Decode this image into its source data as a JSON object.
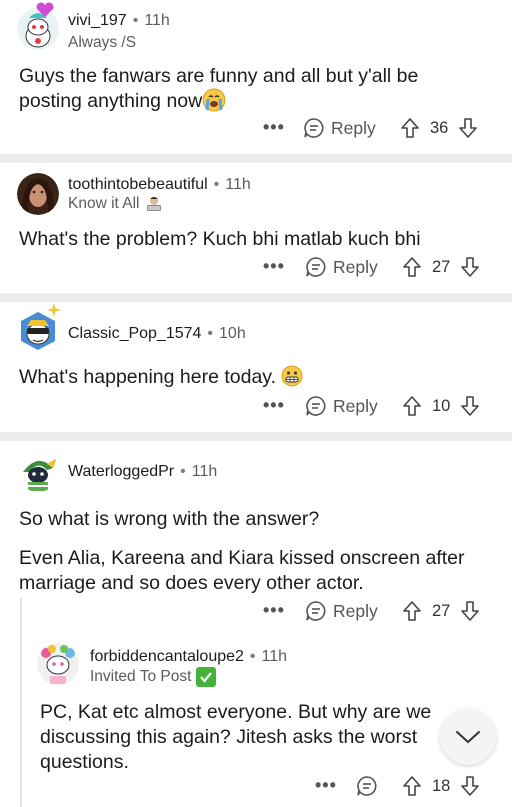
{
  "comments": [
    {
      "username": "vivi_197",
      "time": "11h",
      "flair": "Always /S",
      "text_lines": [
        "Guys the fanwars are funny and all but y'all be",
        "posting anything now"
      ],
      "reply_label": "Reply",
      "votes": "36",
      "avatar_icon": "snoo-avatar-icon",
      "emoji": "crying-face-emoji"
    },
    {
      "username": "toothintobebeautiful",
      "time": "11h",
      "flair": "Know it All",
      "text_lines": [
        "What's the problem? Kuch bhi matlab kuch bhi"
      ],
      "reply_label": "Reply",
      "votes": "27",
      "avatar_icon": "photo-avatar-icon",
      "flair_emoji": "person-at-laptop-emoji"
    },
    {
      "username": "Classic_Pop_1574",
      "time": "10h",
      "flair": "",
      "text_lines": [
        "What's happening here today."
      ],
      "reply_label": "Reply",
      "votes": "10",
      "avatar_icon": "snoo-avatar-icon",
      "emoji": "grimacing-face-emoji"
    },
    {
      "username": "WaterloggedPr",
      "time": "11h",
      "flair": "",
      "text_lines": [
        "So what is wrong with the answer?",
        "Even Alia, Kareena and Kiara kissed onscreen after",
        "marriage and so does every other actor."
      ],
      "reply_label": "Reply",
      "votes": "27",
      "avatar_icon": "snoo-avatar-icon"
    },
    {
      "username": "forbiddencantaloupe2",
      "time": "11h",
      "flair": "Invited To Post",
      "text_lines": [
        "PC, Kat etc almost everyone. But why are we",
        "discussing this again? Jitesh asks the worst",
        "questions."
      ],
      "votes": "18",
      "avatar_icon": "snoo-avatar-icon"
    }
  ],
  "more_label": "•••",
  "colors": {
    "divider": "#ececec",
    "text": "#1c1c1c",
    "muted": "#5c5c5c",
    "check_green": "#45b33a"
  }
}
